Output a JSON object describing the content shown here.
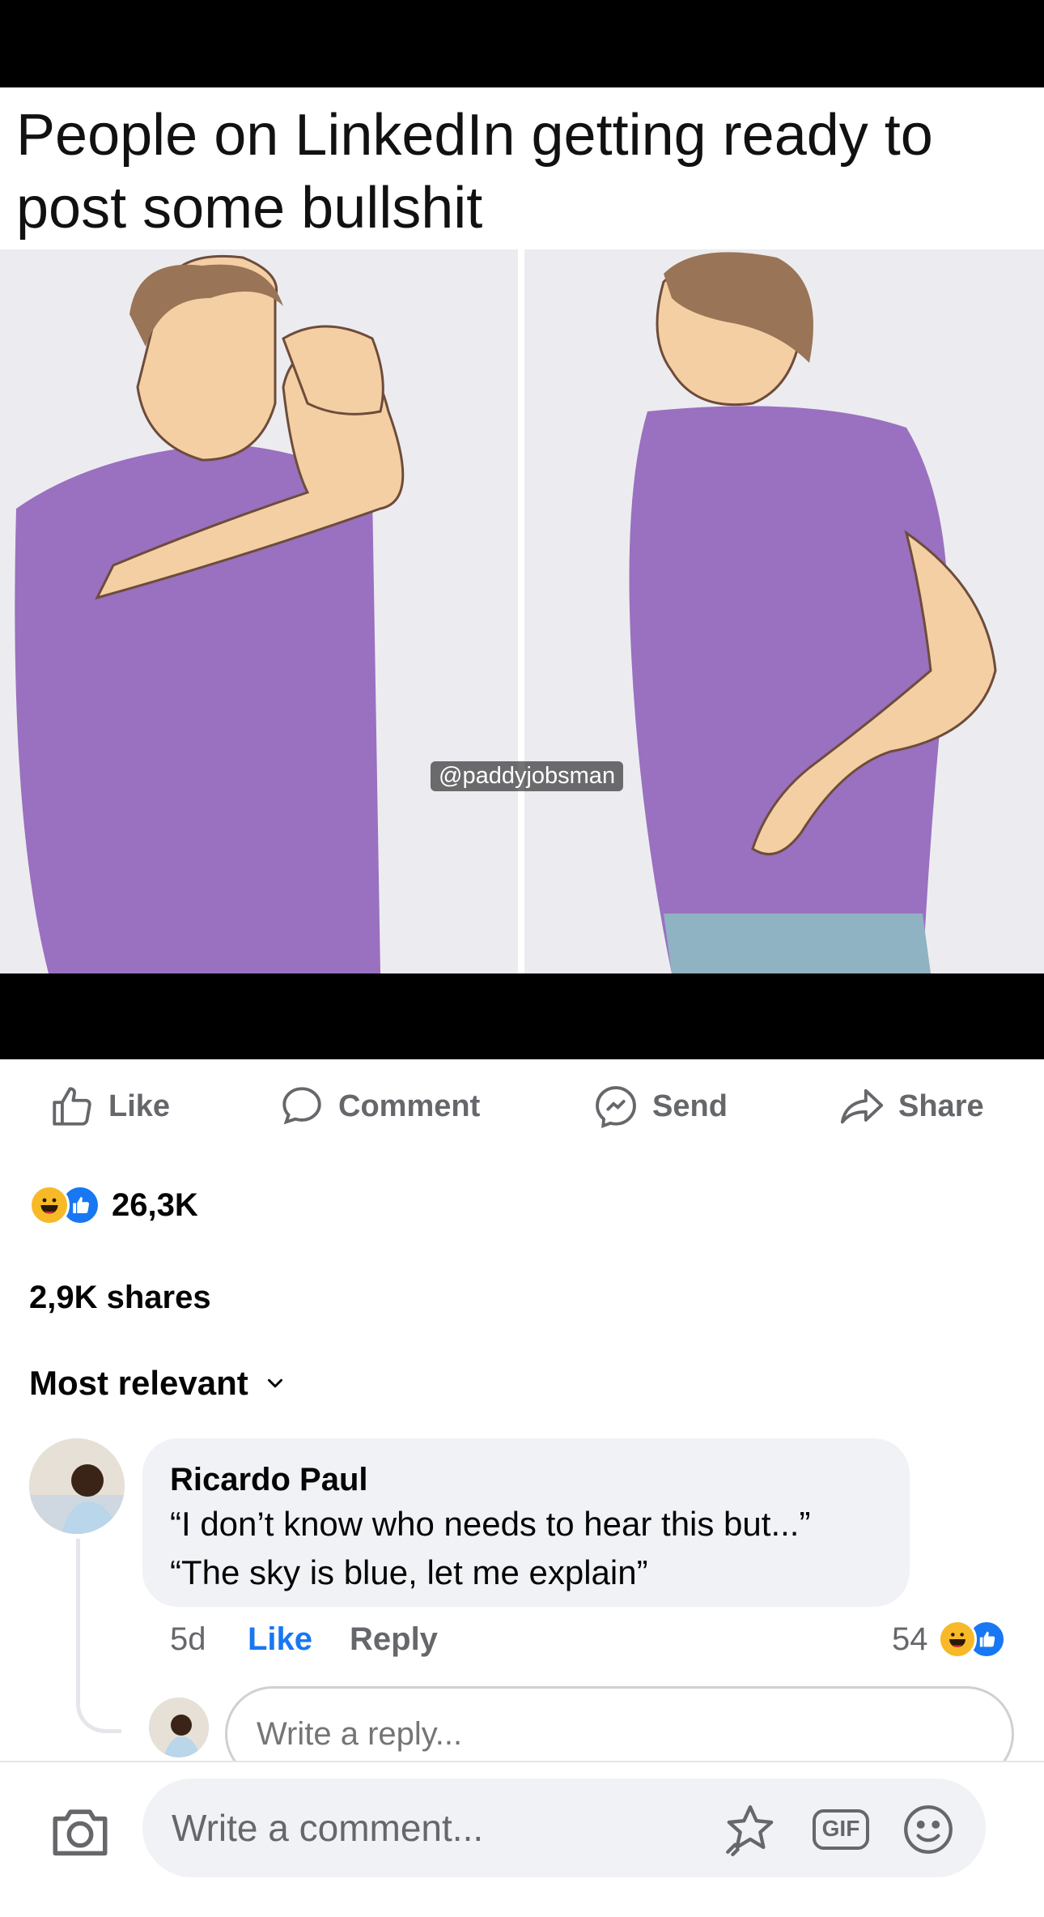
{
  "meme": {
    "caption_line1": "People on LinkedIn getting ready to",
    "caption_line2": "post some bullshit",
    "watermark": "@paddyjobsman"
  },
  "actions": {
    "like": "Like",
    "comment": "Comment",
    "send": "Send",
    "share": "Share",
    "icon_color": "#65676b"
  },
  "reactions": {
    "icons": [
      "haha-icon",
      "like-icon"
    ],
    "count": "26,3K"
  },
  "shares": "2,9K shares",
  "sort": {
    "label": "Most relevant",
    "icon": "chevron-down-icon"
  },
  "comment": {
    "author": "Ricardo Paul",
    "line1": "“I don’t know who needs to hear this but...”",
    "line2": "“The sky is blue, let me explain”",
    "time": "5d",
    "like_label": "Like",
    "reply_label": "Reply",
    "reaction_count": "54",
    "like_color": "#1877f2"
  },
  "reply_box": {
    "placeholder": "Write a reply..."
  },
  "composer": {
    "placeholder": "Write a comment...",
    "icons": [
      "camera-icon",
      "sticker-icon",
      "gif-icon",
      "emoji-icon"
    ],
    "gif_label": "GIF"
  }
}
